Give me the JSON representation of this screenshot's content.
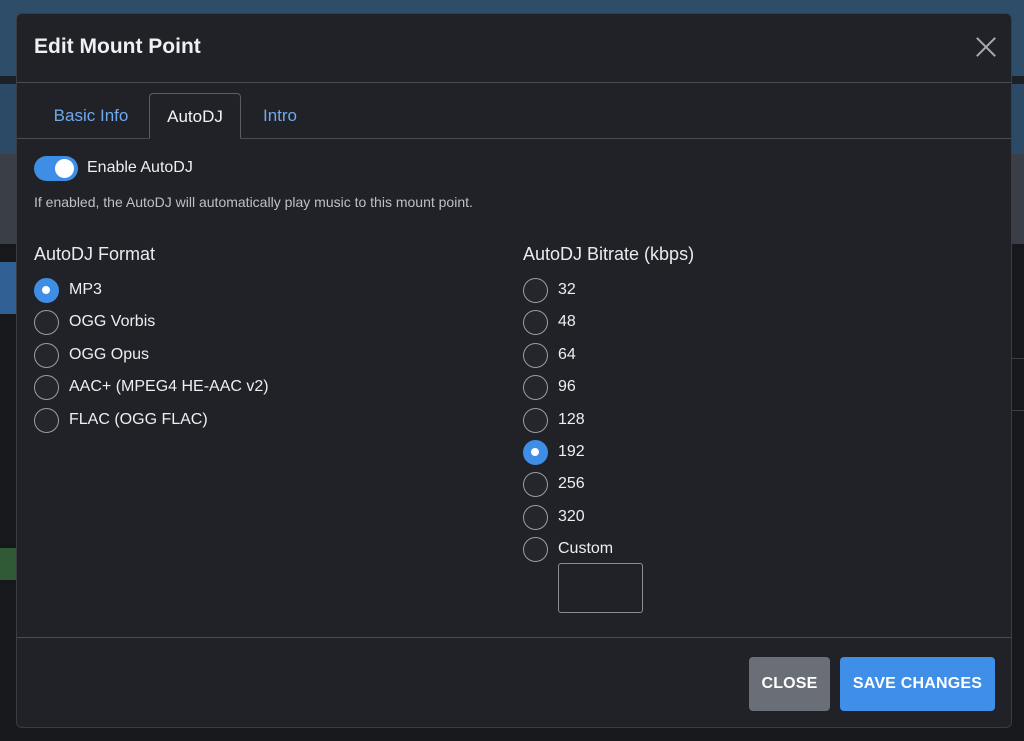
{
  "modal": {
    "title": "Edit Mount Point"
  },
  "tabs": [
    {
      "label": "Basic Info",
      "active": false
    },
    {
      "label": "AutoDJ",
      "active": true
    },
    {
      "label": "Intro",
      "active": false
    }
  ],
  "autodj": {
    "enable_label": "Enable AutoDJ",
    "enabled": true,
    "help_text": "If enabled, the AutoDJ will automatically play music to this mount point.",
    "format": {
      "title": "AutoDJ Format",
      "selected": "MP3",
      "options": [
        "MP3",
        "OGG Vorbis",
        "OGG Opus",
        "AAC+ (MPEG4 HE-AAC v2)",
        "FLAC (OGG FLAC)"
      ]
    },
    "bitrate": {
      "title": "AutoDJ Bitrate (kbps)",
      "selected": "192",
      "options": [
        "32",
        "48",
        "64",
        "96",
        "128",
        "192",
        "256",
        "320",
        "Custom"
      ],
      "custom_value": ""
    }
  },
  "footer": {
    "close_label": "CLOSE",
    "save_label": "SAVE CHANGES"
  },
  "colors": {
    "accent": "#3e8ee6",
    "modal_bg": "#212227",
    "tab_link": "#6fa9ec"
  }
}
